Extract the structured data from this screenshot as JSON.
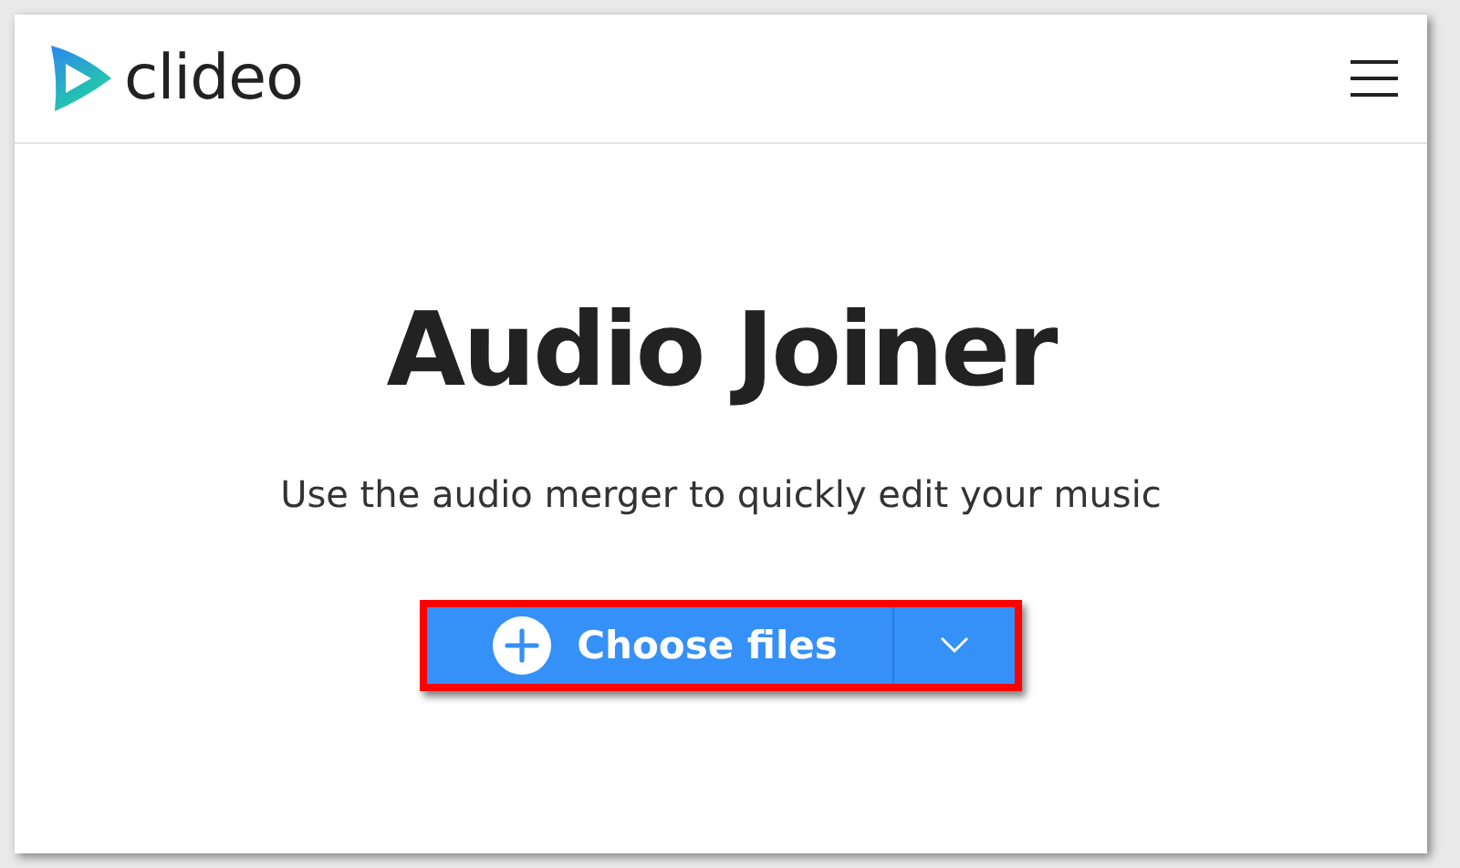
{
  "header": {
    "logo": "clideo"
  },
  "hero": {
    "title": "Audio Joiner",
    "subtitle": "Use the audio merger to quickly edit your music"
  },
  "upload": {
    "label": "Choose files",
    "highlighted": true
  }
}
